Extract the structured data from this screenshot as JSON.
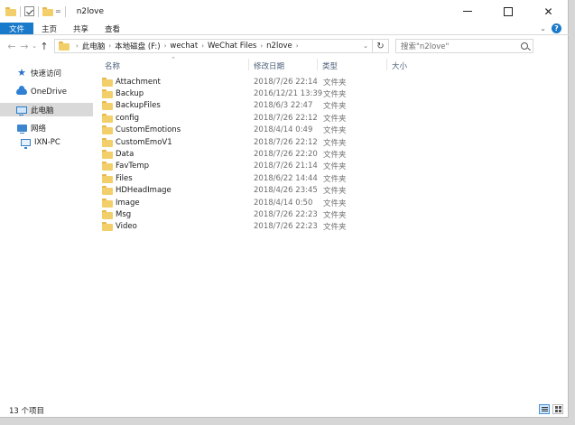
{
  "window": {
    "title": "n2love",
    "quick_access_toolbar": {
      "customize_glyph": "="
    },
    "controls": [
      "minimize",
      "maximize",
      "close"
    ]
  },
  "ribbon": {
    "tabs": [
      {
        "label": "文件",
        "active": true
      },
      {
        "label": "主页"
      },
      {
        "label": "共享"
      },
      {
        "label": "查看"
      }
    ]
  },
  "address": {
    "crumbs": [
      "此电脑",
      "本地磁盘 (F:)",
      "wechat",
      "WeChat Files",
      "n2love"
    ]
  },
  "search": {
    "placeholder": "搜索\"n2love\""
  },
  "navigation_pane": {
    "items": [
      {
        "label": "快速访问",
        "icon": "star-icon"
      },
      {
        "label": "OneDrive",
        "icon": "cloud-icon"
      },
      {
        "label": "此电脑",
        "icon": "computer-icon",
        "selected": true
      },
      {
        "label": "网络",
        "icon": "network-icon"
      },
      {
        "label": "IXN-PC",
        "icon": "monitor-icon"
      }
    ]
  },
  "file_list": {
    "columns": [
      "名称",
      "修改日期",
      "类型",
      "大小"
    ],
    "rows": [
      {
        "name": "Attachment",
        "date": "2018/7/26 22:14",
        "type": "文件夹"
      },
      {
        "name": "Backup",
        "date": "2016/12/21 13:39",
        "type": "文件夹"
      },
      {
        "name": "BackupFiles",
        "date": "2018/6/3 22:47",
        "type": "文件夹"
      },
      {
        "name": "config",
        "date": "2018/7/26 22:12",
        "type": "文件夹"
      },
      {
        "name": "CustomEmotions",
        "date": "2018/4/14 0:49",
        "type": "文件夹"
      },
      {
        "name": "CustomEmoV1",
        "date": "2018/7/26 22:12",
        "type": "文件夹"
      },
      {
        "name": "Data",
        "date": "2018/7/26 22:20",
        "type": "文件夹"
      },
      {
        "name": "FavTemp",
        "date": "2018/7/26 21:14",
        "type": "文件夹"
      },
      {
        "name": "Files",
        "date": "2018/6/22 14:44",
        "type": "文件夹"
      },
      {
        "name": "HDHeadImage",
        "date": "2018/4/26 23:45",
        "type": "文件夹"
      },
      {
        "name": "Image",
        "date": "2018/4/14 0:50",
        "type": "文件夹"
      },
      {
        "name": "Msg",
        "date": "2018/7/26 22:23",
        "type": "文件夹"
      },
      {
        "name": "Video",
        "date": "2018/7/26 22:23",
        "type": "文件夹"
      }
    ]
  },
  "status": {
    "item_count": "13 个项目"
  },
  "colors": {
    "file_tab_bg": "#1979ca",
    "folder_yellow": "#f3cf6b",
    "selection_bg": "#d9d9d9",
    "header_text": "#4c607a"
  }
}
